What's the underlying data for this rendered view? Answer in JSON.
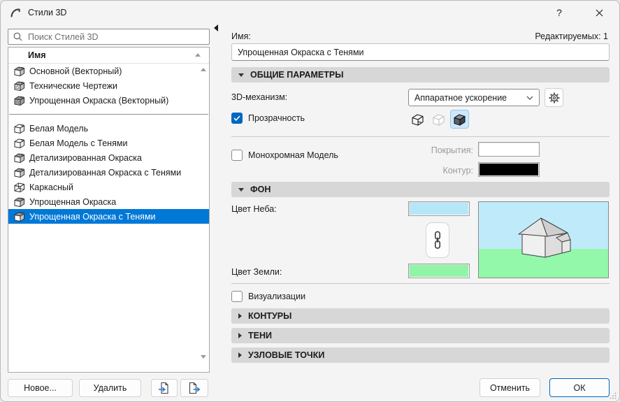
{
  "window": {
    "title": "Стили 3D",
    "help_label": "?"
  },
  "left_panel": {
    "search": {
      "placeholder": "Поиск Стилей 3D"
    },
    "list_header": "Имя",
    "items": [
      {
        "label": "Основной (Векторный)",
        "icon": "cube-shaded"
      },
      {
        "label": "Технические Чертежи",
        "icon": "cube-hatched"
      },
      {
        "label": "Упрощенная Окраска (Векторный)",
        "icon": "cube-hatched-shaded"
      },
      {
        "divider": true
      },
      {
        "label": "Белая Модель",
        "icon": "cube-white"
      },
      {
        "label": "Белая Модель с Тенями",
        "icon": "cube-white"
      },
      {
        "label": "Детализированная Окраска",
        "icon": "cube-shaded"
      },
      {
        "label": "Детализированная Окраска с Тенями",
        "icon": "cube-shaded"
      },
      {
        "label": "Каркасный",
        "icon": "cube-wire"
      },
      {
        "label": "Упрощенная Окраска",
        "icon": "cube-shaded"
      },
      {
        "label": "Упрощенная Окраска с Тенями",
        "icon": "cube-shaded",
        "selected": true
      }
    ],
    "new_button": "Новое...",
    "delete_button": "Удалить"
  },
  "right_panel": {
    "name_label": "Имя:",
    "editable_count_label": "Редактируемых: 1",
    "name_value": "Упрощенная Окраска с Тенями",
    "general": {
      "title": "ОБЩИЕ ПАРАМЕТРЫ",
      "engine_label": "3D-механизм:",
      "engine_value": "Аппаратное ускорение",
      "transparency": {
        "label": "Прозрачность",
        "checked": true
      },
      "monochrome": {
        "label": "Монохромная Модель",
        "checked": false
      },
      "surfaces_label": "Покрытия:",
      "surfaces_color": "#ffffff",
      "contour_label": "Контур:",
      "contour_color": "#000000"
    },
    "background": {
      "title": "ФОН",
      "sky_label": "Цвет Неба:",
      "sky_color": "#b5e7f9",
      "ground_label": "Цвет Земли:",
      "ground_color": "#90f5a6",
      "preview": {
        "sky": "#bfeafa",
        "ground": "#93f8a9"
      }
    },
    "visualization": {
      "label": "Визуализации",
      "checked": false
    },
    "collapsed_sections": [
      {
        "title": "КОНТУРЫ"
      },
      {
        "title": "ТЕНИ"
      },
      {
        "title": "УЗЛОВЫЕ ТОЧКИ"
      }
    ],
    "cancel_button": "Отменить",
    "ok_button": "ОК"
  },
  "colors": {
    "selection": "#0078d7",
    "checkbox_accent": "#0067c0",
    "ok_border": "#0067c0"
  }
}
